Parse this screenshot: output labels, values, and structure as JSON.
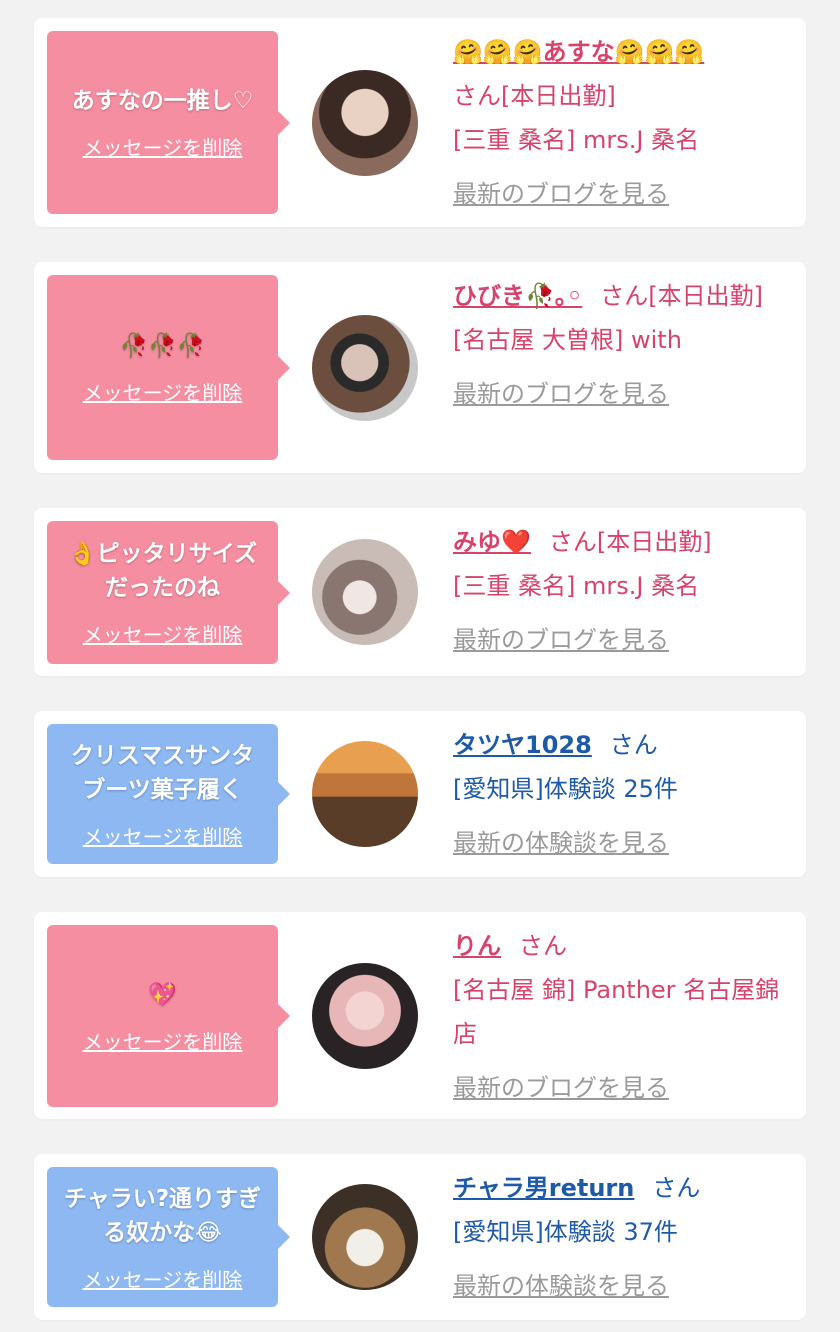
{
  "cards": [
    {
      "message": "あすなの一推し♡",
      "delete_label": "メッセージを削除",
      "name": "あすな",
      "name_prefix_emoji": "🤗🤗🤗",
      "name_suffix_emoji": "🤗🤗🤗",
      "suffix": "さん[本日出勤]",
      "shop": "[三重 桑名] mrs.J 桑名",
      "link": "最新のブログを見る"
    },
    {
      "message": "🥀🥀🥀",
      "delete_label": "メッセージを削除",
      "name": "ひびき🥀｡◦",
      "suffix": "さん[本日出勤]",
      "shop": "[名古屋 大曽根] with",
      "link": "最新のブログを見る"
    },
    {
      "message": "👌ピッタリサイズだったのね",
      "delete_label": "メッセージを削除",
      "name": "みゆ❤️",
      "suffix": "さん[本日出勤]",
      "shop": "[三重 桑名] mrs.J 桑名",
      "link": "最新のブログを見る"
    },
    {
      "message": "クリスマスサンタブーツ菓子履く",
      "delete_label": "メッセージを削除",
      "name": "タツヤ1028",
      "suffix": "さん",
      "shop": "[愛知県]体験談 25件",
      "link": "最新の体験談を見る"
    },
    {
      "message": "💖",
      "delete_label": "メッセージを削除",
      "name": "りん",
      "suffix": "さん",
      "shop": "[名古屋 錦] Panther 名古屋錦店",
      "link": "最新のブログを見る"
    },
    {
      "message": "チャラい?通りすぎる奴かな😂",
      "delete_label": "メッセージを削除",
      "name": "チャラ男return",
      "suffix": "さん",
      "shop": "[愛知県]体験談 37件",
      "link": "最新の体験談を見る"
    }
  ],
  "colors": {
    "pink_bubble": "#f58ea1",
    "blue_bubble": "#8db8f2",
    "pink_text": "#d8436b",
    "blue_text": "#1e5aa8",
    "gray_link": "#9a9a9a"
  }
}
